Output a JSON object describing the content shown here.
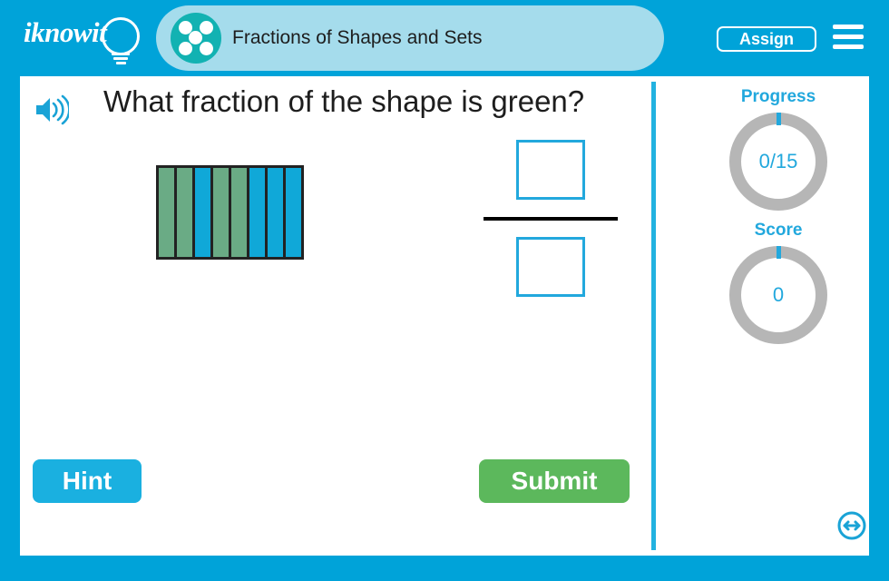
{
  "app": {
    "brand": "iknowit",
    "frame_color": "#00a3d9"
  },
  "header": {
    "title": "Fractions of Shapes and Sets",
    "title_band_color": "#a5dcec",
    "topic_icon": "five-dots-circle-icon",
    "assign_label": "Assign",
    "menu_icon": "hamburger-menu-icon"
  },
  "question": {
    "audio_icon": "speaker-icon",
    "text": "What fraction of the shape is green?"
  },
  "shape": {
    "name": "fraction-bar-shape",
    "total_parts": 8,
    "green_parts": 4,
    "blue_parts": 4,
    "green_color": "#6aab85",
    "blue_color": "#10a8d8",
    "segments": [
      "green",
      "green",
      "blue",
      "green",
      "green",
      "blue",
      "blue",
      "blue"
    ]
  },
  "answer": {
    "numerator": "",
    "denominator": "",
    "numerator_placeholder": "",
    "denominator_placeholder": ""
  },
  "sidebar": {
    "progress": {
      "label": "Progress",
      "value": "0/15",
      "ring_color": "#b6b6b6",
      "tick_color": "#22a8dd"
    },
    "score": {
      "label": "Score",
      "value": "0",
      "ring_color": "#b6b6b6",
      "tick_color": "#22a8dd"
    }
  },
  "footer": {
    "hint_label": "Hint",
    "hint_color": "#1ab0e0",
    "submit_label": "Submit",
    "submit_color": "#5cb85c",
    "resize_icon": "resize-horizontal-icon"
  }
}
